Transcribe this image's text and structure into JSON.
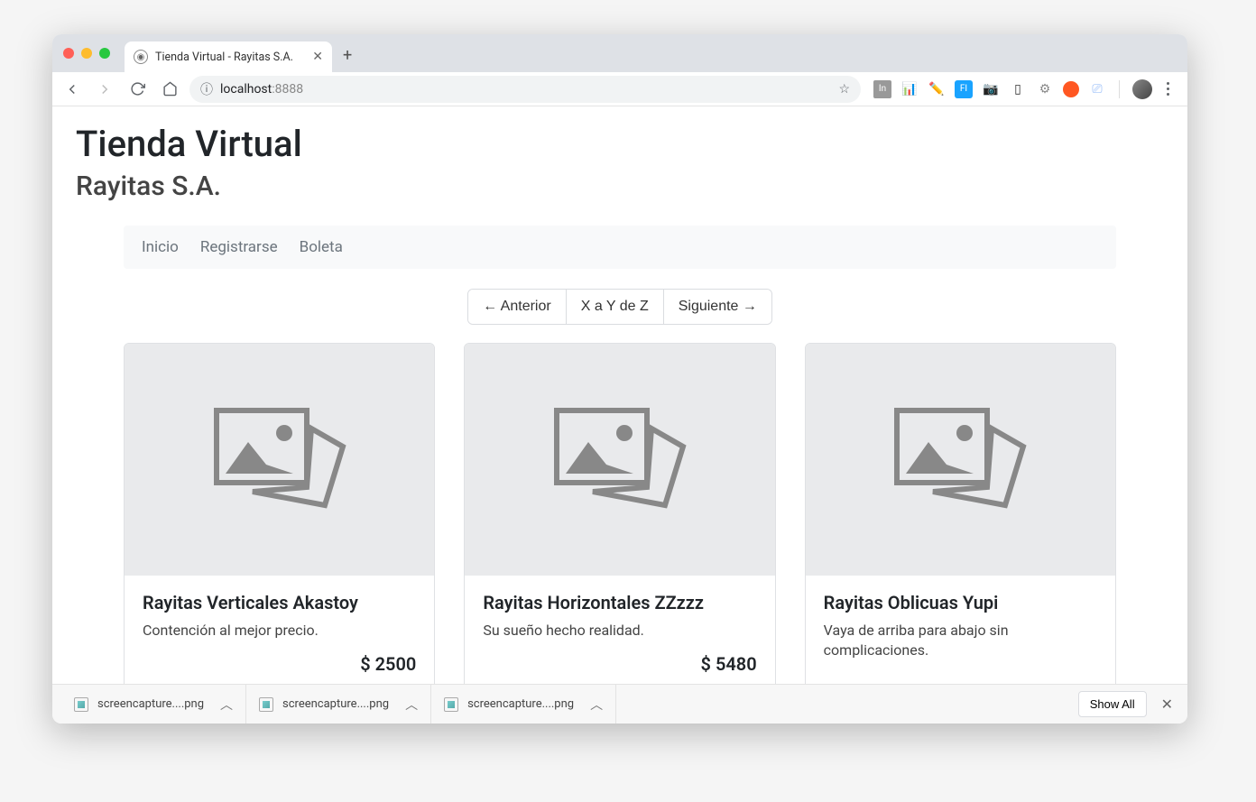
{
  "browser": {
    "tab_title": "Tienda Virtual - Rayitas S.A.",
    "url_host": "localhost",
    "url_port": ":8888"
  },
  "page": {
    "title": "Tienda Virtual",
    "subtitle": "Rayitas S.A.",
    "nav": {
      "items": [
        "Inicio",
        "Registrarse",
        "Boleta"
      ]
    },
    "pagination": {
      "prev": "← Anterior",
      "range": "X a Y de Z",
      "next": "Siguiente →"
    },
    "products": [
      {
        "title": "Rayitas Verticales Akastoy",
        "desc": "Contención al mejor precio.",
        "price": "$ 2500"
      },
      {
        "title": "Rayitas Horizontales ZZzzz",
        "desc": "Su sueño hecho realidad.",
        "price": "$ 5480"
      },
      {
        "title": "Rayitas Oblicuas Yupi",
        "desc": "Vaya de arriba para abajo sin complicaciones.",
        "price": ""
      }
    ]
  },
  "downloads": {
    "items": [
      {
        "name": "screencapture....png"
      },
      {
        "name": "screencapture....png"
      },
      {
        "name": "screencapture....png"
      }
    ],
    "show_all": "Show All"
  }
}
